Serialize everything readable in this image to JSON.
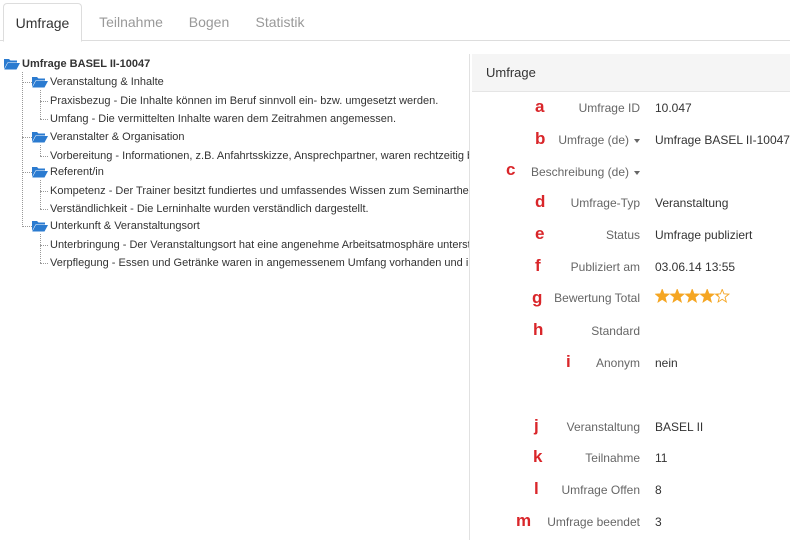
{
  "tabs": [
    {
      "label": "Umfrage",
      "active": true
    },
    {
      "label": "Teilnahme",
      "active": false
    },
    {
      "label": "Bogen",
      "active": false
    },
    {
      "label": "Statistik",
      "active": false
    }
  ],
  "tree": {
    "root": "Umfrage BASEL II-10047",
    "groups": [
      {
        "label": "Veranstaltung & Inhalte",
        "items": [
          "Praxisbezug - Die Inhalte können im Beruf sinnvoll ein- bzw. umgesetzt werden.",
          "Umfang - Die vermittelten Inhalte waren dem Zeitrahmen angemessen."
        ]
      },
      {
        "label": "Veranstalter & Organisation",
        "items": [
          "Vorbereitung - Informationen, z.B. Anfahrtsskizze, Ansprechpartner, waren rechtzeitig beim"
        ]
      },
      {
        "label": "Referent/in",
        "items": [
          "Kompetenz - Der Trainer besitzt fundiertes und umfassendes Wissen zum Seminarthema.",
          "Verständlichkeit - Die Lerninhalte wurden verständlich dargestellt."
        ]
      },
      {
        "label": "Unterkunft & Veranstaltungsort",
        "items": [
          "Unterbringung - Der Veranstaltungsort hat eine angenehme Arbeitsatmosphäre unterstützt",
          "Verpflegung - Essen und Getränke waren in angemessenem Umfang vorhanden und in gute"
        ]
      }
    ]
  },
  "panel": {
    "title": "Umfrage",
    "fields": [
      {
        "marker": "a",
        "label": "Umfrage ID",
        "value": "10.047",
        "caret": false
      },
      {
        "marker": "b",
        "label": "Umfrage (de)",
        "value": "Umfrage BASEL II-10047",
        "caret": true
      },
      {
        "marker": "c",
        "label": "Beschreibung (de)",
        "value": "",
        "caret": true
      },
      {
        "marker": "d",
        "label": "Umfrage-Typ",
        "value": "Veranstaltung",
        "caret": false
      },
      {
        "marker": "e",
        "label": "Status",
        "value": "Umfrage publiziert",
        "caret": false
      },
      {
        "marker": "f",
        "label": "Publiziert am",
        "value": "03.06.14 13:55",
        "caret": false
      },
      {
        "marker": "g",
        "label": "Bewertung Total",
        "value": "",
        "caret": false
      },
      {
        "marker": "h",
        "label": "Standard",
        "value": "",
        "caret": false
      },
      {
        "marker": "i",
        "label": "Anonym",
        "value": "nein",
        "caret": false
      },
      {
        "marker": "j",
        "label": "Veranstaltung",
        "value": "BASEL II",
        "caret": false
      },
      {
        "marker": "k",
        "label": "Teilnahme",
        "value": "11",
        "caret": false
      },
      {
        "marker": "l",
        "label": "Umfrage Offen",
        "value": "8",
        "caret": false
      },
      {
        "marker": "m",
        "label": "Umfrage beendet",
        "value": "3",
        "caret": false
      }
    ],
    "rating": {
      "value": 4.25,
      "max": 5,
      "star_color": "#f5a623",
      "empty_color": "#f5a623"
    }
  },
  "icons": {
    "folder": "folder-open-icon",
    "folder_color": "#2b7bd0"
  },
  "colors": {
    "marker": "#d9262a",
    "active_tab_text": "#333333",
    "inactive_tab_text": "#999999"
  }
}
